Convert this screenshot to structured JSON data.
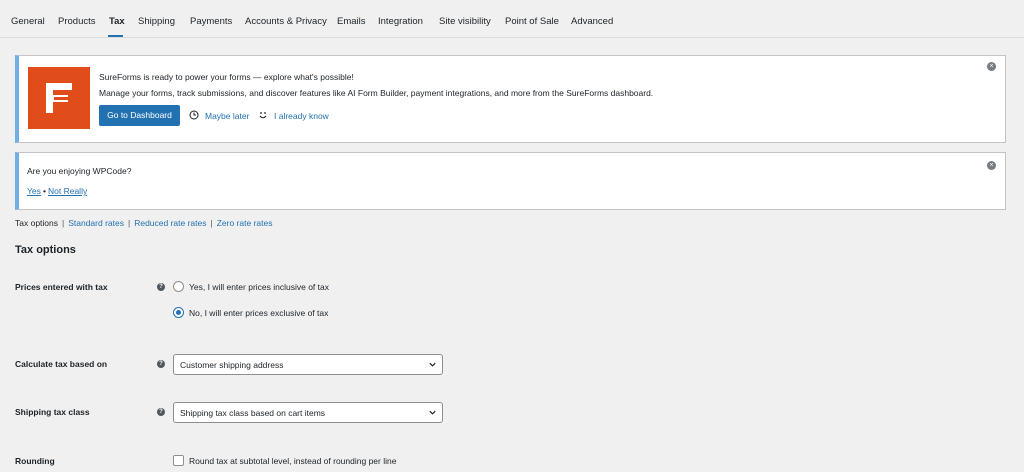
{
  "tabs": [
    {
      "label": "General"
    },
    {
      "label": "Products"
    },
    {
      "label": "Tax"
    },
    {
      "label": "Shipping"
    },
    {
      "label": "Payments"
    },
    {
      "label": "Accounts & Privacy"
    },
    {
      "label": "Emails"
    },
    {
      "label": "Integration"
    },
    {
      "label": "Site visibility"
    },
    {
      "label": "Point of Sale"
    },
    {
      "label": "Advanced"
    }
  ],
  "active_tab": "Tax",
  "sureforms_notice": {
    "headline": "SureForms is ready to power your forms — explore what's possible!",
    "body": "Manage your forms, track submissions, and discover features like AI Form Builder, payment integrations, and more from the SureForms dashboard.",
    "primary_button": "Go to Dashboard",
    "maybe_later": "Maybe later",
    "already_know": "I already know"
  },
  "wpcode_notice": {
    "question": "Are you enjoying WPCode?",
    "yes": "Yes",
    "bullet": "•",
    "no": "Not Really"
  },
  "subnav": {
    "current": "Tax options",
    "items": [
      "Standard rates",
      "Reduced rate rates",
      "Zero rate rates"
    ],
    "separator": "|"
  },
  "section_title": "Tax options",
  "fields": {
    "prices_entered": {
      "label": "Prices entered with tax",
      "options": [
        "Yes, I will enter prices inclusive of tax",
        "No, I will enter prices exclusive of tax"
      ],
      "selected_index": 1
    },
    "calculate_based_on": {
      "label": "Calculate tax based on",
      "value": "Customer shipping address"
    },
    "shipping_tax_class": {
      "label": "Shipping tax class",
      "value": "Shipping tax class based on cart items"
    },
    "rounding": {
      "label": "Rounding",
      "checkbox_label": "Round tax at subtotal level, instead of rounding per line",
      "checked": false
    }
  },
  "colors": {
    "accent": "#2271b1",
    "sureforms_brand": "#e14d1a",
    "notice_border": "#72aee6"
  }
}
